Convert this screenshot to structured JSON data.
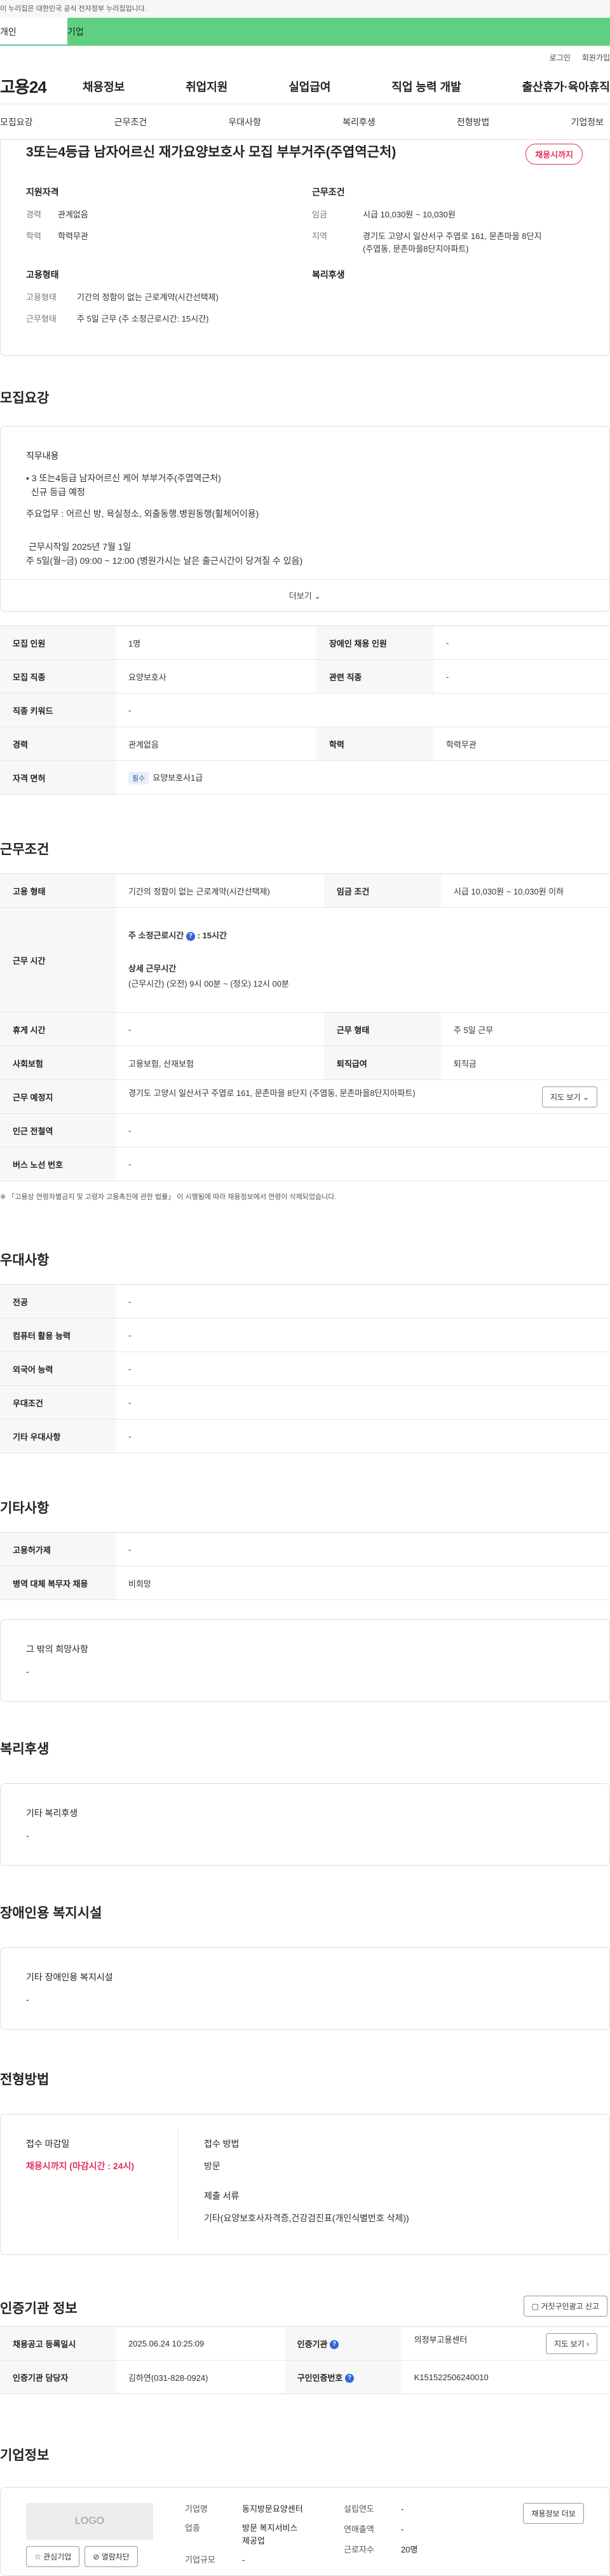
{
  "gov_banner": "이 누리집은 대한민국 공식 전자정부 누리집입니다.",
  "top_tabs": {
    "individual": "개인",
    "company": "기업"
  },
  "util": {
    "login": "로그인",
    "join": "회원가입"
  },
  "logo": "고용24",
  "gnb": [
    "채용정보",
    "취업지원",
    "실업급여",
    "직업 능력 개발",
    "출산휴가·육아휴직"
  ],
  "anchors": [
    "모집요강",
    "근무조건",
    "우대사항",
    "복리후생",
    "전형방법",
    "기업정보"
  ],
  "job": {
    "title": "3또는4등급 남자어르신 재가요양보호사 모집 부부거주(주엽역근처)",
    "badge": "채용시까지",
    "summary": {
      "qual_head": "지원자격",
      "career_k": "경력",
      "career_v": "관계없음",
      "edu_k": "학력",
      "edu_v": "학력무관",
      "cond_head": "근무조건",
      "wage_k": "임금",
      "wage_v": "시급 10,030원 ~ 10,030원",
      "loc_k": "지역",
      "loc_v1": "경기도 고양시 일산서구 주엽로 161, 문촌마을 8단지",
      "loc_v2": "(주엽동, 문촌마을8단지아파트)",
      "emp_head": "고용형태",
      "emp_k": "고용형태",
      "emp_v": "기간의 정함이 없는 근로계약(시간선택제)",
      "work_k": "근무형태",
      "work_v": "주 5일 근무 (주 소정근로시간: 15시간)",
      "welfare_head": "복리후생"
    }
  },
  "recruit": {
    "section": "모집요강",
    "duty_head": "직무내용",
    "duty_lines": [
      "• 3 또는4등급 남자어르신 케어 부부거주(주엽역근처)",
      "  신규 등급 예정",
      "주요업무 : 어르신 방, 욕실청소, 외출동행.병원동행(휠체어이용)",
      "근무시작일 2025년 7월 1일",
      "주 5일(월~금) 09:00 ~ 12:00 (병원가시는 날은 출근시간이 당겨질 수 있음)"
    ],
    "more": "더보기",
    "rows": {
      "count_k": "모집 인원",
      "count_v": "1명",
      "disab_k": "장애인 채용 인원",
      "disab_v": "-",
      "job_k": "모집 직종",
      "job_v": "요양보호사",
      "rel_k": "관련 직종",
      "rel_v": "-",
      "kw_k": "직종 키워드",
      "kw_v": "-",
      "career_k": "경력",
      "career_v": "관계없음",
      "edu_k": "학력",
      "edu_v": "학력무관",
      "lic_k": "자격 면허",
      "lic_tag": "필수",
      "lic_v": "요양보호사1급"
    }
  },
  "cond": {
    "section": "근무조건",
    "emp_k": "고용 형태",
    "emp_v": "기간의 정함이 없는 근로계약(시간선택제)",
    "wage_k": "임금 조건",
    "wage_v": "시급 10,030원 ~ 10,030원 이하",
    "time_k": "근무 시간",
    "weekly": "주 소정근로시간",
    "weekly_v": ": 15시간",
    "detail_head": "상세 근무시간",
    "detail_v": "(근무시간) (오전) 9시 00분 ~ (정오) 12시 00분",
    "rest_k": "휴게 시간",
    "rest_v": "-",
    "worktype_k": "근무 형태",
    "worktype_v": "주 5일 근무",
    "ins_k": "사회보험",
    "ins_v": "고용보험, 산재보험",
    "sev_k": "퇴직급여",
    "sev_v": "퇴직금",
    "place_k": "근무 예정지",
    "place_v": "경기도 고양시 일산서구 주엽로 161, 문촌마을 8단지 (주엽동, 문촌마을8단지아파트)",
    "map_btn": "지도 보기",
    "subway_k": "인근 전철역",
    "subway_v": "-",
    "bus_k": "버스 노선 번호",
    "bus_v": "-",
    "note": "※ 「고용상 연령차별금지 및 고령자 고용촉진에 관한 법률」 이 시행됨에 따라 채용정보에서 연령이 삭제되었습니다."
  },
  "pref": {
    "section": "우대사항",
    "rows": [
      [
        "전공",
        "-"
      ],
      [
        "컴퓨터 활용 능력",
        "-"
      ],
      [
        "외국어 능력",
        "-"
      ],
      [
        "우대조건",
        "-"
      ],
      [
        "기타 우대사항",
        "-"
      ]
    ]
  },
  "etc": {
    "section": "기타사항",
    "rows": [
      [
        "고용허가제",
        "-"
      ],
      [
        "병역 대체 복무자 채용",
        "비희망"
      ]
    ],
    "hope_head": "그 밖의 희망사항",
    "hope_v": "-"
  },
  "welfare": {
    "section": "복리후생",
    "head": "기타 복리후생",
    "v": "-"
  },
  "disab": {
    "section": "장애인용 복지시설",
    "head": "기타 장애인용 복지시설",
    "v": "-"
  },
  "screen": {
    "section": "전형방법",
    "deadline_head": "접수 마감일",
    "deadline_v": "채용시까지 (마감시간 : 24시)",
    "method_head": "접수 방법",
    "method_v": "방문",
    "docs_head": "제출 서류",
    "docs_v": "기타(요양보호사자격증,건강검진표(개인식별번호 삭제))"
  },
  "agency": {
    "section": "인증기관 정보",
    "report_btn": "거짓구인광고 신고",
    "reg_k": "채용공고 등록일시",
    "reg_v": "2025.06.24 10:25:09",
    "org_k": "인증기관",
    "org_v": "의정부고용센터",
    "map_btn": "지도 보기",
    "mgr_k": "인증기관 담당자",
    "mgr_v": "김하연(031-828-0924)",
    "no_k": "구인인증번호",
    "no_v": "K151522506240010"
  },
  "company": {
    "section": "기업정보",
    "logo": "LOGO",
    "fav": "관심기업",
    "block": "열람차단",
    "name_k": "기업명",
    "name_v": "동지방문요양센터",
    "ind_k": "업종",
    "ind_v1": "방문 복지서비스",
    "ind_v2": "제공업",
    "size_k": "기업규모",
    "size_v": "-",
    "year_k": "설립연도",
    "year_v": "-",
    "sales_k": "연매출액",
    "sales_v": "-",
    "emp_k": "근로자수",
    "emp_v": "20명",
    "jobs_btn": "채용정보 더보"
  },
  "colors": {
    "green": "#5fd07f",
    "red": "#e5325b",
    "blue": "#2f67d8"
  }
}
